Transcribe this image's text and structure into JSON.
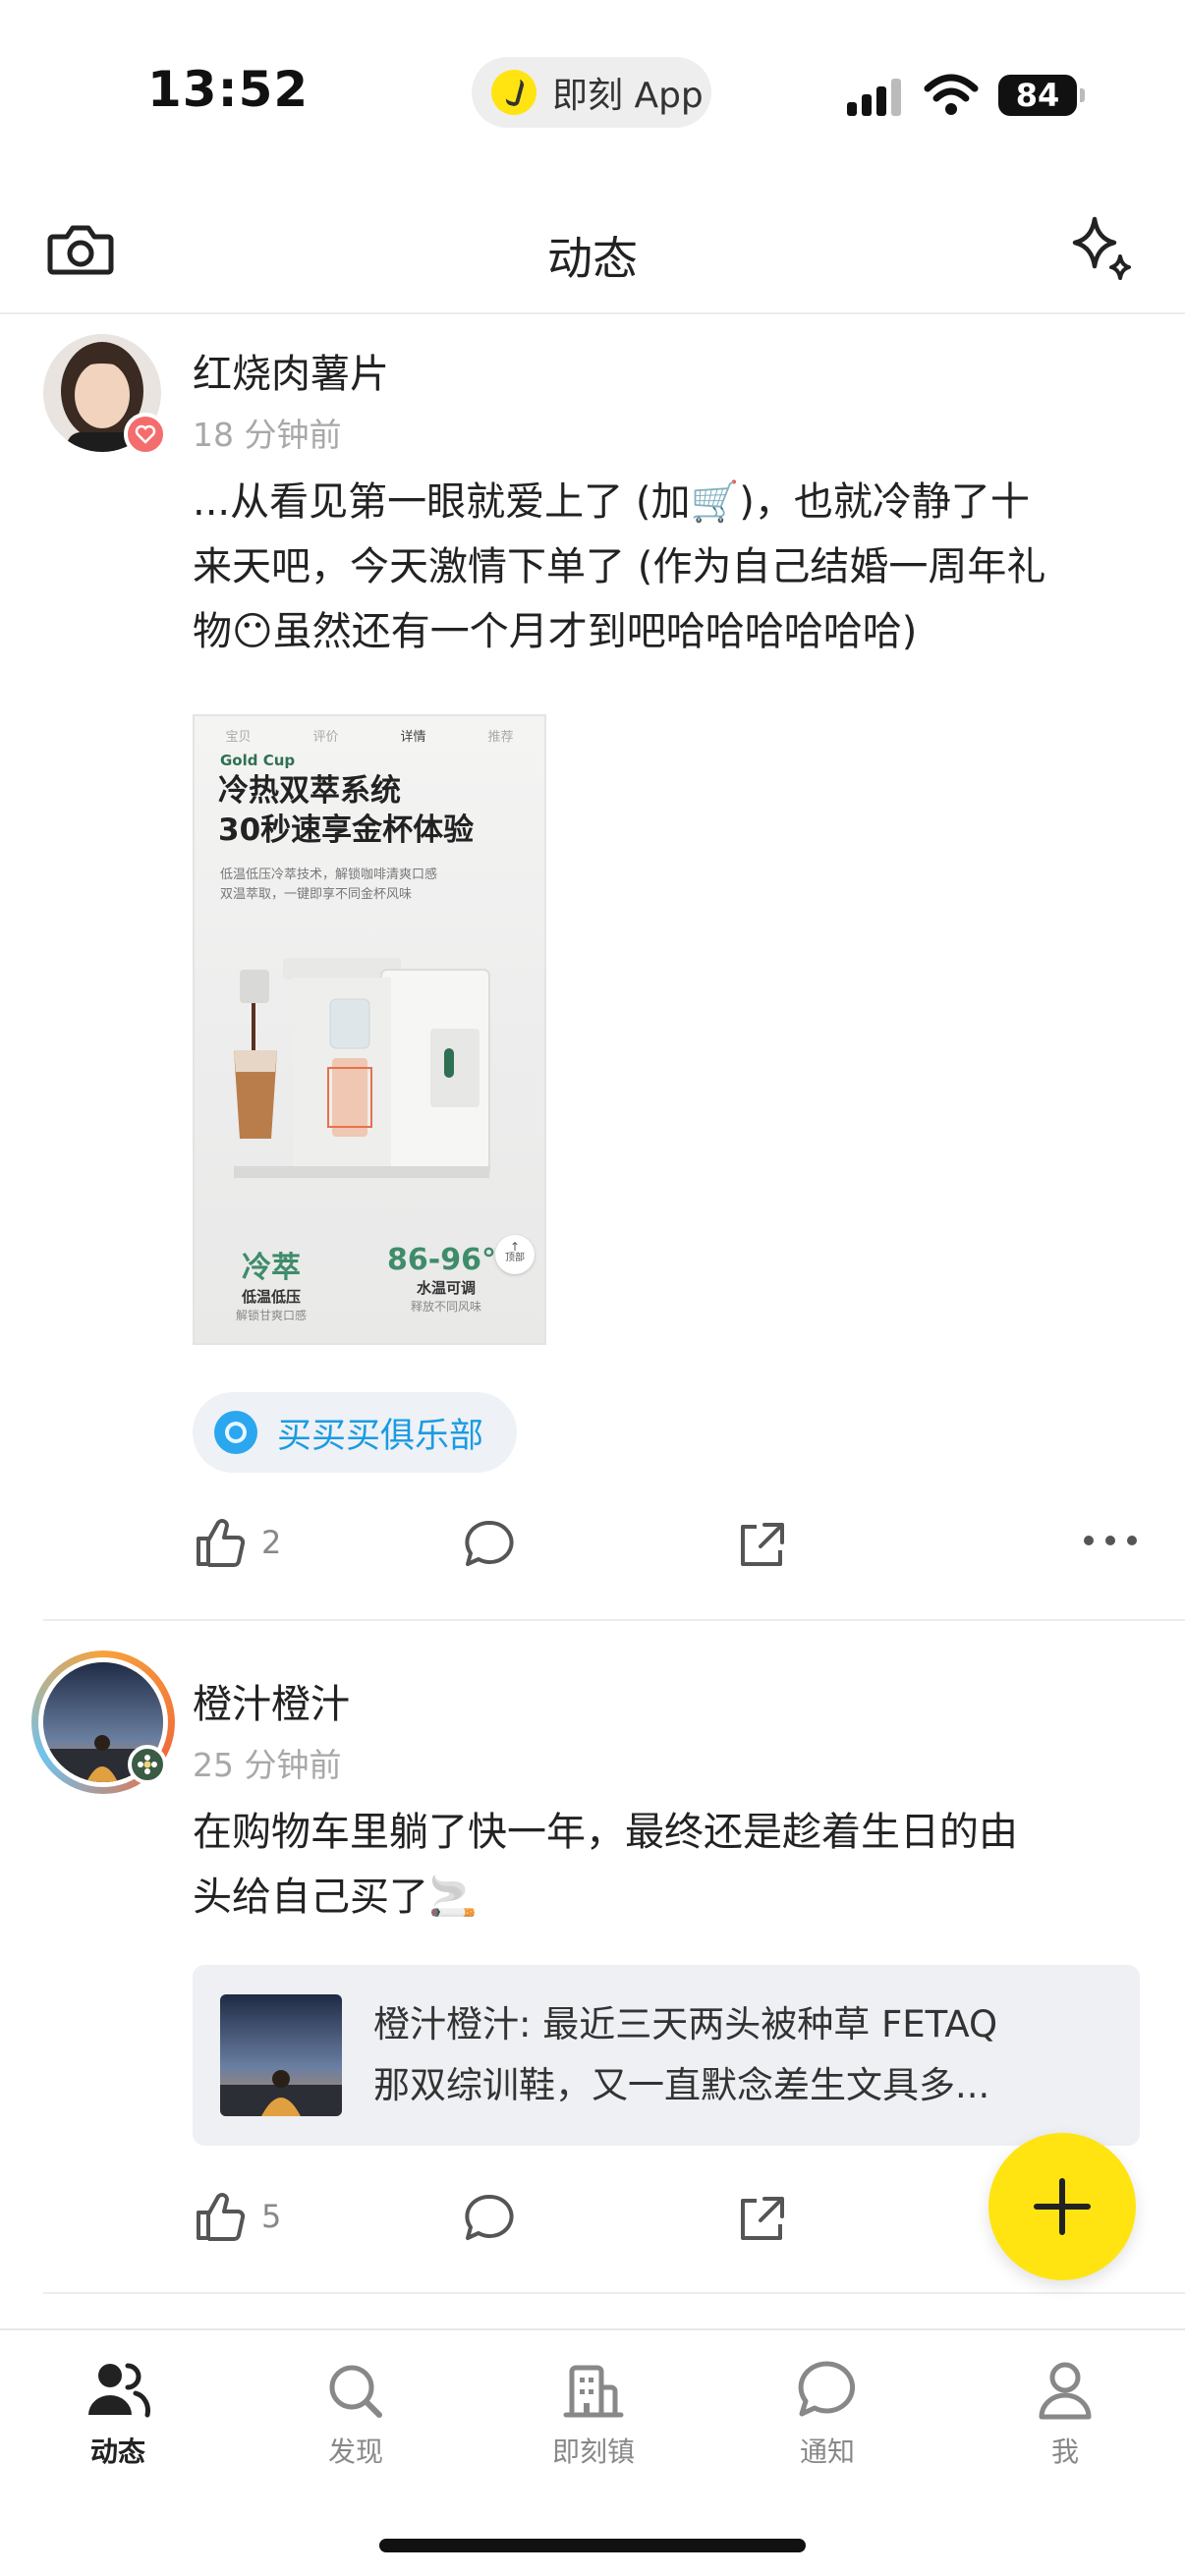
{
  "status_bar": {
    "time": "13:52",
    "app_label": "即刻 App",
    "battery": "84"
  },
  "header": {
    "title": "动态",
    "left_icon": "camera-icon",
    "right_icon": "sparkle-icon"
  },
  "posts": [
    {
      "username": "红烧肉薯片",
      "time": "18 分钟前",
      "text_lines": [
        "...从看见第一眼就爱上了 (加🛒)，也就冷静了十",
        "来天吧，今天激情下单了 (作为自己结婚一周年礼",
        "物😶虽然还有一个月才到吧哈哈哈哈哈哈)"
      ],
      "image": {
        "tabs": [
          "宝贝",
          "评价",
          "详情",
          "推荐"
        ],
        "brand": "Gold Cup",
        "headline_1": "冷热双萃系统",
        "headline_2": "30秒速享金杯体验",
        "sub_1": "低温低压冷萃技术，解锁咖啡清爽口感",
        "sub_2": "双温萃取，一键即享不同金杯风味",
        "stat_left_big": "冷萃",
        "stat_left_mid": "低温低压",
        "stat_left_small": "解锁甘爽口感",
        "stat_right_big": "86-96℃",
        "stat_right_mid": "水温可调",
        "stat_right_small": "释放不同风味",
        "top_button": "顶部"
      },
      "topic": "买买买俱乐部",
      "likes": "2"
    },
    {
      "username": "橙汁橙汁",
      "time": "25 分钟前",
      "text_lines": [
        "在购物车里躺了快一年，最终还是趁着生日的由",
        "头给自己买了🚬"
      ],
      "shared": {
        "line_1": "橙汁橙汁: 最近三天两头被种草 FETAQ",
        "line_2": "那双综训鞋，又一直默念差生文具多..."
      },
      "likes": "5"
    }
  ],
  "fab_icon": "plus-icon",
  "tabs": [
    {
      "label": "动态",
      "icon": "users-icon",
      "active": true
    },
    {
      "label": "发现",
      "icon": "search-icon",
      "active": false
    },
    {
      "label": "即刻镇",
      "icon": "town-icon",
      "active": false
    },
    {
      "label": "通知",
      "icon": "chat-bubble-icon",
      "active": false
    },
    {
      "label": "我",
      "icon": "person-icon",
      "active": false
    }
  ],
  "colors": {
    "accent_yellow": "#FFE411",
    "topic_blue": "#1A9BE3",
    "muted_text": "#A8A8A8"
  }
}
